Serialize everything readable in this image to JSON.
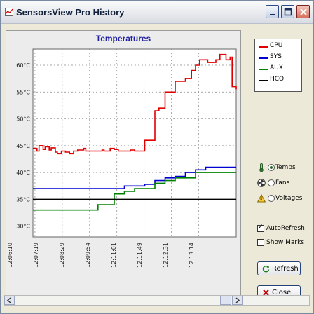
{
  "window": {
    "title": "SensorsView Pro History"
  },
  "chart_data": {
    "type": "line",
    "title": "Temperatures",
    "y_tick_labels": [
      "30°C",
      "35°C",
      "40°C",
      "45°C",
      "50°C",
      "55°C",
      "60°C"
    ],
    "x_tick_labels": [
      "12:06:10",
      "12:07:19",
      "12:08:29",
      "12:09:54",
      "12:11:01",
      "12:11:49",
      "12:12:31",
      "12:13:14"
    ],
    "ylim": [
      28,
      63
    ],
    "xlim": [
      0,
      100
    ],
    "grid": true,
    "legend_position": "right",
    "series": [
      {
        "name": "CPU",
        "color": "#e00000",
        "x": [
          0,
          2,
          3,
          5,
          6,
          8,
          9,
          11,
          12,
          14,
          16,
          18,
          20,
          22,
          25,
          26,
          30,
          34,
          35,
          38,
          40,
          42,
          45,
          48,
          50,
          52,
          55,
          60,
          62,
          65,
          70,
          75,
          78,
          80,
          82,
          84,
          86,
          90,
          92,
          95,
          97,
          98,
          100
        ],
        "values": [
          44.5,
          44,
          45,
          44.3,
          44.8,
          44.2,
          44.6,
          43.8,
          43.5,
          44,
          43.8,
          43.5,
          44,
          44.2,
          44.5,
          44,
          44,
          44.2,
          44,
          44.5,
          44.3,
          44,
          44,
          44.2,
          44,
          44,
          46,
          51.5,
          52,
          55,
          57,
          57.5,
          59,
          60,
          61,
          61,
          60.5,
          61,
          62,
          61,
          61.5,
          56,
          55.5
        ]
      },
      {
        "name": "SYS",
        "color": "#0000d0",
        "x": [
          0,
          30,
          42,
          45,
          55,
          60,
          65,
          70,
          75,
          80,
          85,
          90,
          95,
          100
        ],
        "values": [
          37,
          37,
          37,
          37.5,
          37.8,
          38.5,
          39,
          39.3,
          40,
          40.5,
          41,
          41,
          41,
          41
        ]
      },
      {
        "name": "AUX",
        "color": "#008000",
        "x": [
          0,
          20,
          30,
          32,
          40,
          45,
          50,
          55,
          60,
          65,
          70,
          75,
          80,
          85,
          90,
          95,
          100
        ],
        "values": [
          33,
          33,
          33,
          34,
          36,
          36.5,
          37,
          37,
          38,
          38.5,
          39,
          39,
          40,
          40,
          40,
          40,
          40
        ]
      },
      {
        "name": "HCO",
        "color": "#000000",
        "x": [
          0,
          100
        ],
        "values": [
          35,
          35
        ]
      }
    ]
  },
  "options": {
    "temps_label": "Temps",
    "fans_label": "Fans",
    "voltages_label": "Voltages",
    "selected": "Temps",
    "autorefresh_label": "AutoRefresh",
    "autorefresh_checked": true,
    "showmarks_label": "Show Marks",
    "showmarks_checked": false
  },
  "buttons": {
    "refresh_label": "Refresh",
    "close_label": "Close"
  },
  "icons": {
    "window": "chart-icon",
    "temps": "thermometer-icon",
    "fans": "fan-icon",
    "voltages": "lightning-icon",
    "refresh": "refresh-icon",
    "close": "close-icon"
  },
  "colors": {
    "cpu": "#e00000",
    "sys": "#0000d0",
    "aux": "#008000",
    "hco": "#000000",
    "title_blue": "#1f1fa0"
  }
}
